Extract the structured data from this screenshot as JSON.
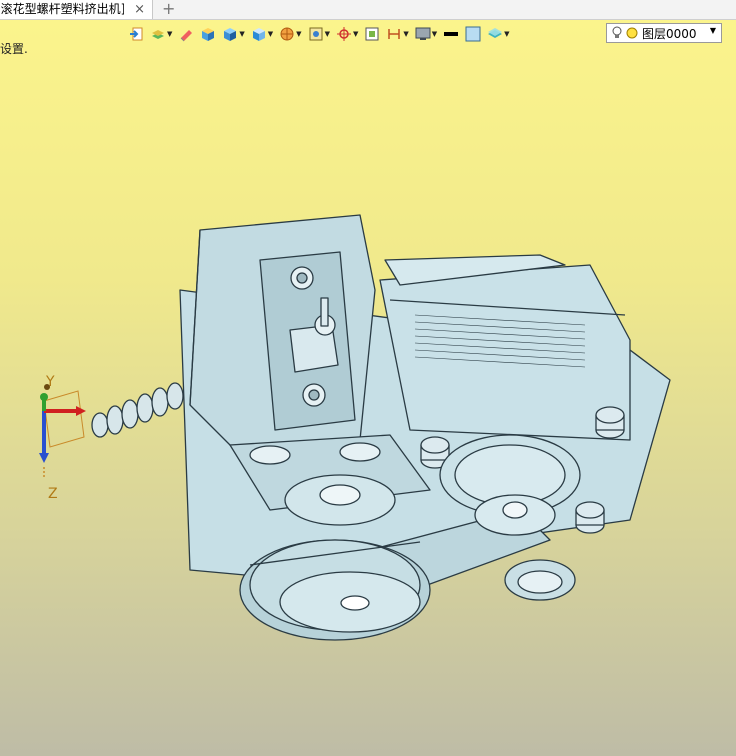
{
  "tab": {
    "title": "[滚花型螺杆塑料挤出机]",
    "close_glyph": "×",
    "add_glyph": "+"
  },
  "viewport": {
    "hint": "设置.",
    "colors": {
      "top": "#fbf48c",
      "bottom": "#bebca6",
      "model": "#b5d3dc",
      "model_edge": "#2a3b44"
    }
  },
  "toolbar": {
    "icons": [
      "exit-sketch-icon",
      "layer-stack-icon",
      "eraser-icon",
      "cube-shaded-icon",
      "cube-blue-icon",
      "cube-view-icon",
      "sphere-display-icon",
      "selection-filter-icon",
      "snap-target-icon",
      "frame-icon",
      "dimension-icon",
      "monitor-icon",
      "line-color-icon",
      "fill-color-icon",
      "layer-tools-icon",
      "lightbulb-icon"
    ],
    "layer": {
      "value": "图层0000"
    }
  },
  "axes": {
    "y": "Y",
    "z": "Z"
  }
}
